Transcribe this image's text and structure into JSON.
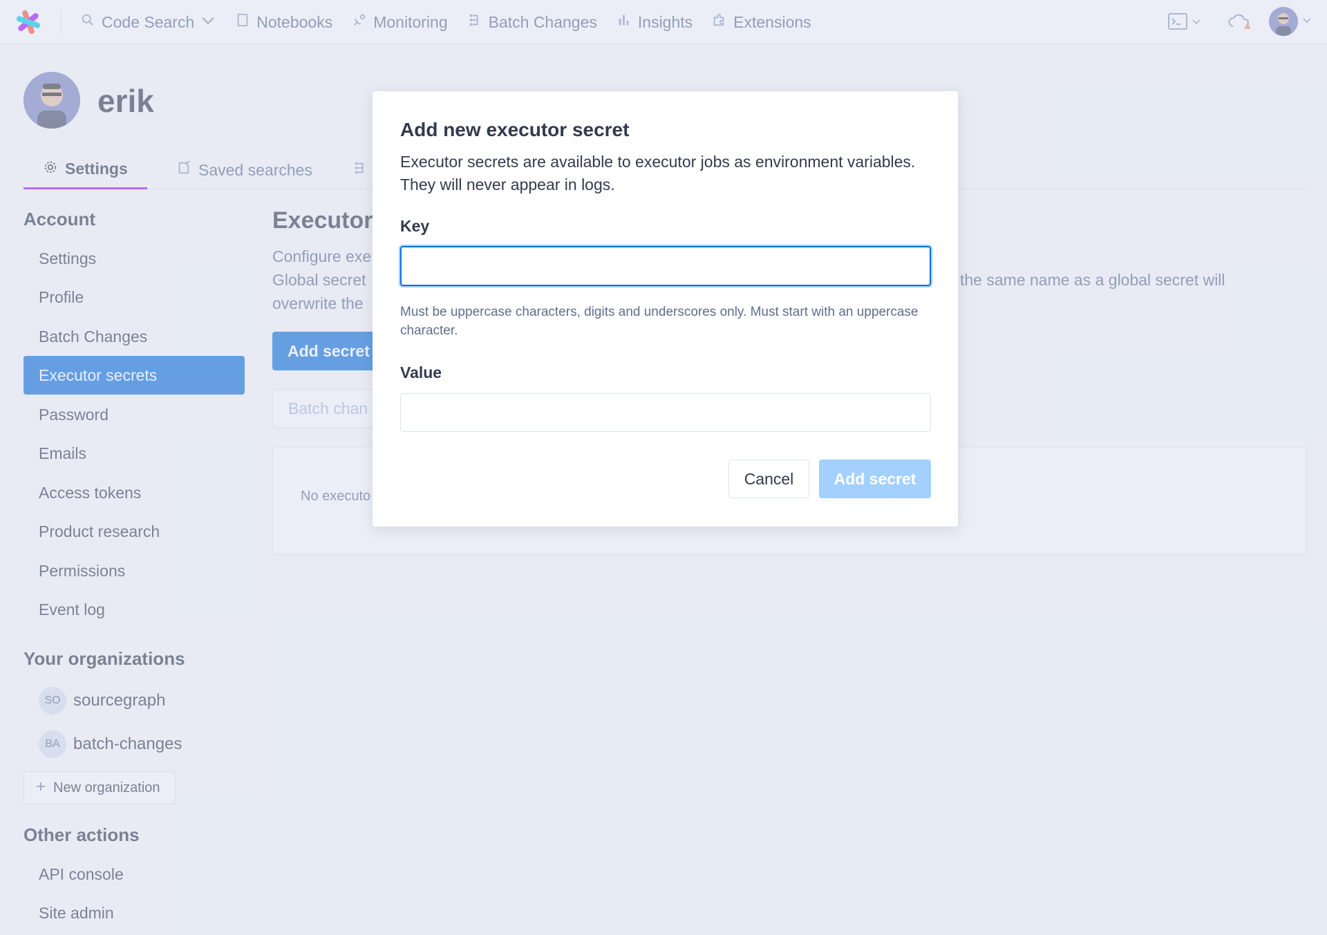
{
  "nav": {
    "items": [
      {
        "label": "Code Search",
        "icon": "search-icon"
      },
      {
        "label": "Notebooks",
        "icon": "notebook-icon"
      },
      {
        "label": "Monitoring",
        "icon": "satellite-icon"
      },
      {
        "label": "Batch Changes",
        "icon": "batch-changes-icon"
      },
      {
        "label": "Insights",
        "icon": "bar-chart-icon"
      },
      {
        "label": "Extensions",
        "icon": "puzzle-icon"
      }
    ]
  },
  "user": {
    "name": "erik"
  },
  "tabs": {
    "settings": "Settings",
    "saved_searches": "Saved searches"
  },
  "sidebar": {
    "account_heading": "Account",
    "items": [
      {
        "label": "Settings"
      },
      {
        "label": "Profile"
      },
      {
        "label": "Batch Changes"
      },
      {
        "label": "Executor secrets"
      },
      {
        "label": "Password"
      },
      {
        "label": "Emails"
      },
      {
        "label": "Access tokens"
      },
      {
        "label": "Product research"
      },
      {
        "label": "Permissions"
      },
      {
        "label": "Event log"
      }
    ],
    "orgs_heading": "Your organizations",
    "orgs": [
      {
        "badge": "SO",
        "name": "sourcegraph"
      },
      {
        "badge": "BA",
        "name": "batch-changes"
      }
    ],
    "new_org_label": "New organization",
    "other_heading": "Other actions",
    "other_items": [
      {
        "label": "API console"
      },
      {
        "label": "Site admin"
      }
    ]
  },
  "main": {
    "title": "Executor",
    "desc_line1": "Configure exe",
    "desc_line2": "Global secret",
    "desc_line2_tail": "the same name as a global secret will",
    "desc_line3": "overwrite the",
    "add_button": "Add secret",
    "filter_placeholder": "Batch chan",
    "empty_text": "No executo"
  },
  "modal": {
    "title": "Add new executor secret",
    "description": "Executor secrets are available to executor jobs as environment variables. They will never appear in logs.",
    "key_label": "Key",
    "key_value": "",
    "key_help": "Must be uppercase characters, digits and underscores only. Must start with an uppercase character.",
    "value_label": "Value",
    "value_value": "",
    "cancel_label": "Cancel",
    "submit_label": "Add secret"
  },
  "colors": {
    "accent": "#0b70db",
    "active_tab_underline": "#a112ff",
    "disabled_button": "#a3d0ff"
  }
}
